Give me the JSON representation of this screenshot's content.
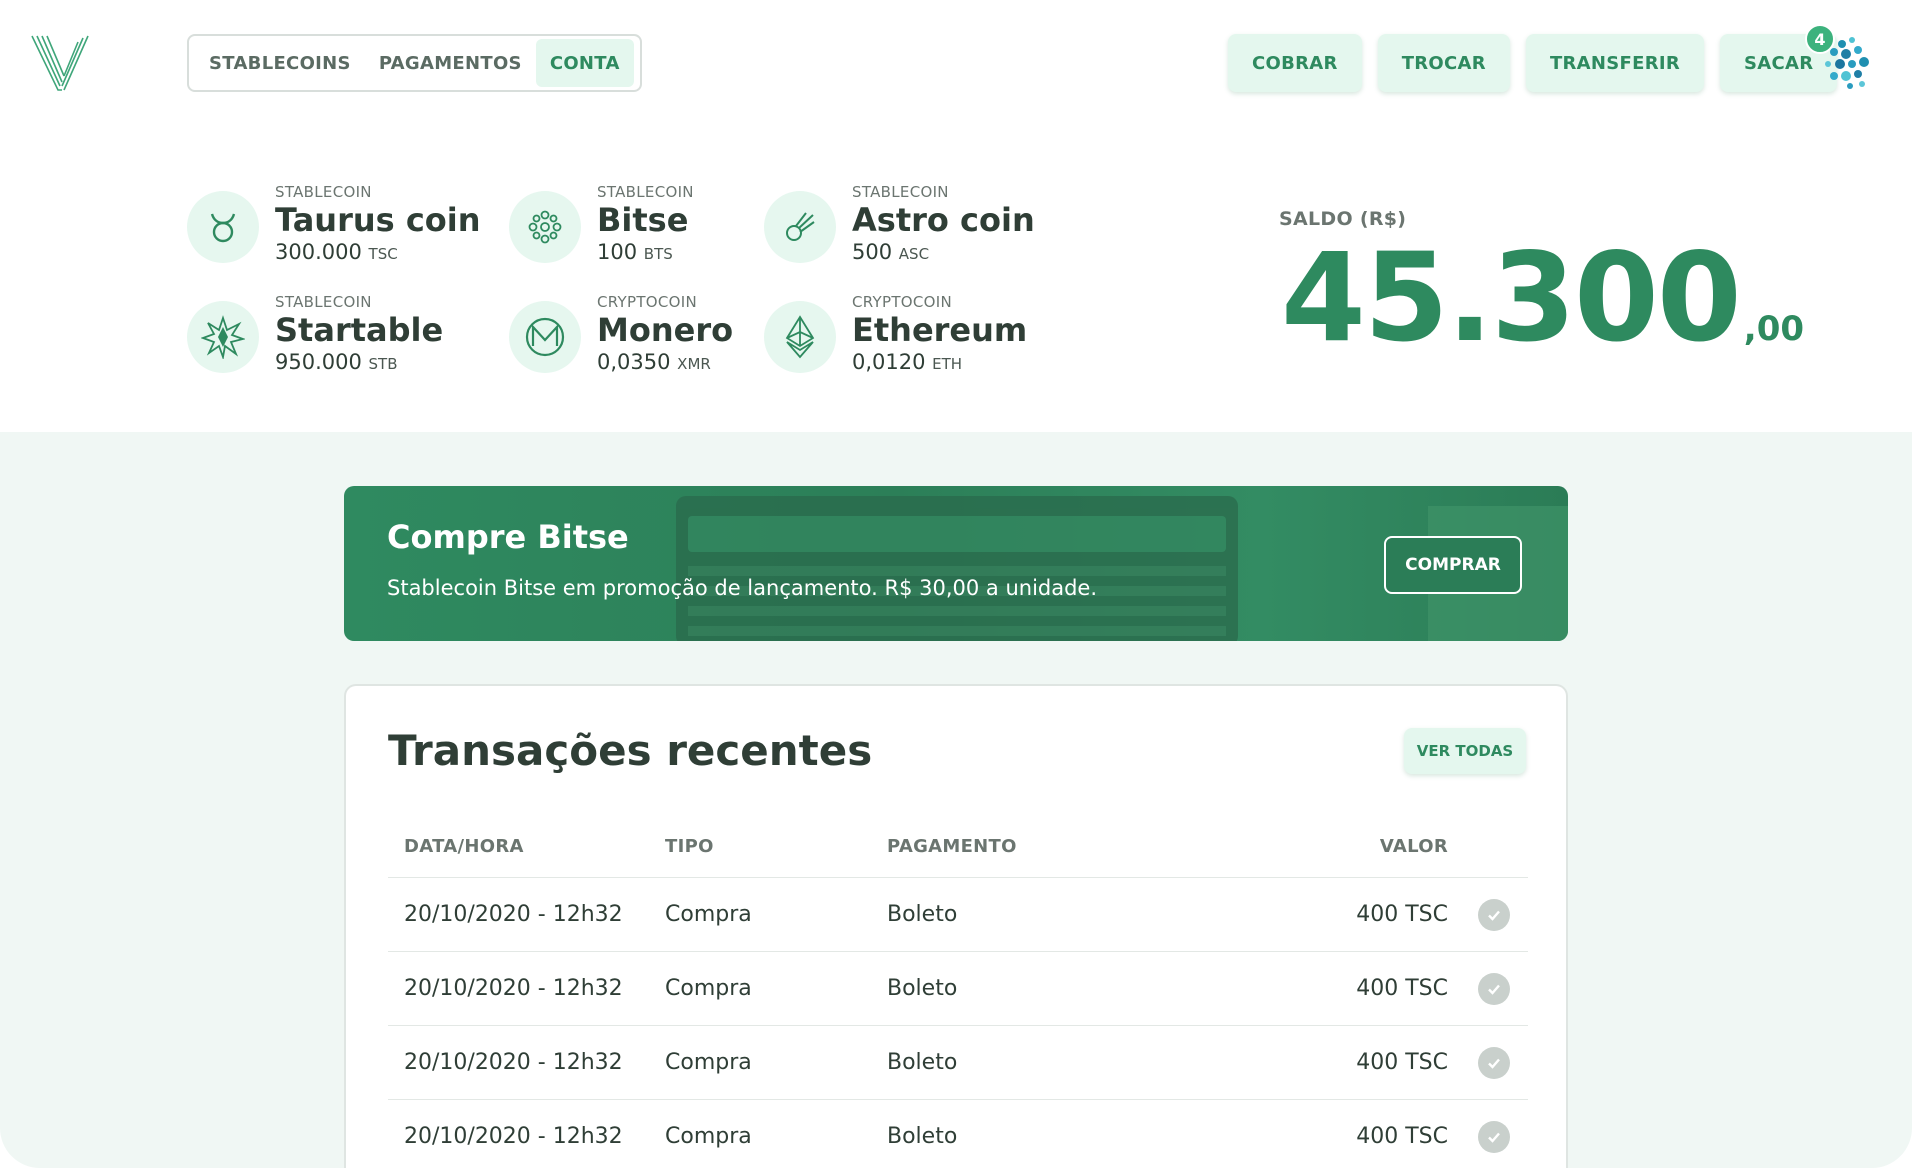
{
  "header": {
    "nav": [
      {
        "label": "STABLECOINS",
        "active": false
      },
      {
        "label": "PAGAMENTOS",
        "active": false
      },
      {
        "label": "CONTA",
        "active": true
      }
    ],
    "actions": [
      "COBRAR",
      "TROCAR",
      "TRANSFERIR",
      "SACAR"
    ],
    "notification_count": "4",
    "icons": {
      "logo": "v-logo",
      "avatar": "user-avatar-icon"
    }
  },
  "coins": [
    {
      "category": "STABLECOIN",
      "name": "Taurus coin",
      "amount": "300.000",
      "unit": "TSC",
      "icon": "taurus-icon"
    },
    {
      "category": "STABLECOIN",
      "name": "Bitse",
      "amount": "100",
      "unit": "BTS",
      "icon": "bitse-icon"
    },
    {
      "category": "STABLECOIN",
      "name": "Astro coin",
      "amount": "500",
      "unit": "ASC",
      "icon": "comet-icon"
    },
    {
      "category": "STABLECOIN",
      "name": "Startable",
      "amount": "950.000",
      "unit": "STB",
      "icon": "star-icon"
    },
    {
      "category": "CRYPTOCOIN",
      "name": "Monero",
      "amount": "0,0350",
      "unit": "XMR",
      "icon": "monero-icon"
    },
    {
      "category": "CRYPTOCOIN",
      "name": "Ethereum",
      "amount": "0,0120",
      "unit": "ETH",
      "icon": "ethereum-icon"
    }
  ],
  "balance": {
    "label": "SALDO (R$)",
    "integer": "45.300",
    "decimal": ",00"
  },
  "promo": {
    "title": "Compre Bitse",
    "text": "Stablecoin Bitse em promoção de lançamento. R$ 30,00 a unidade.",
    "button": "COMPRAR"
  },
  "transactions": {
    "title": "Transações recentes",
    "view_all": "VER TODAS",
    "columns": [
      "DATA/HORA",
      "TIPO",
      "PAGAMENTO",
      "VALOR"
    ],
    "rows": [
      {
        "datetime": "20/10/2020 - 12h32",
        "type": "Compra",
        "payment": "Boleto",
        "value": "400 TSC"
      },
      {
        "datetime": "20/10/2020 - 12h32",
        "type": "Compra",
        "payment": "Boleto",
        "value": "400 TSC"
      },
      {
        "datetime": "20/10/2020 - 12h32",
        "type": "Compra",
        "payment": "Boleto",
        "value": "400 TSC"
      },
      {
        "datetime": "20/10/2020 - 12h32",
        "type": "Compra",
        "payment": "Boleto",
        "value": "400 TSC"
      }
    ]
  },
  "colors": {
    "accent": "#2e8a5f",
    "accent_light": "#e4f7ee",
    "section_bg": "#f0f7f4"
  }
}
